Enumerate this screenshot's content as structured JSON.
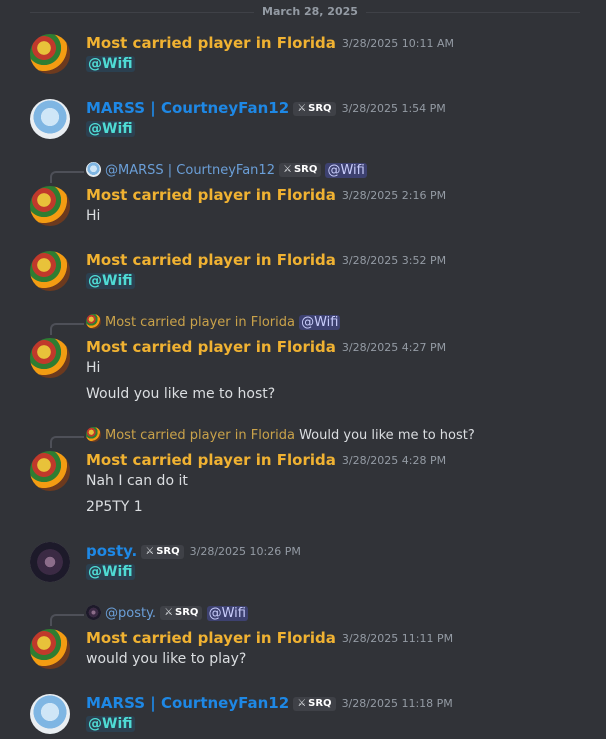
{
  "date_divider": "March 28, 2025",
  "messages": [
    {
      "author": "Most carried player in Florida",
      "time": "3/28/2025 10:11 AM",
      "lines": [
        "@Wifi"
      ]
    },
    {
      "author": "MARSS | CourtneyFan12",
      "tag": "SRQ",
      "time": "3/28/2025 1:54 PM",
      "lines": [
        "@Wifi"
      ]
    },
    {
      "reply_author": "@MARSS | CourtneyFan12",
      "reply_tag": "SRQ",
      "reply_text": "@Wifi",
      "author": "Most carried player in Florida",
      "time": "3/28/2025 2:16 PM",
      "lines": [
        "Hi"
      ]
    },
    {
      "author": "Most carried player in Florida",
      "time": "3/28/2025 3:52 PM",
      "lines": [
        "@Wifi"
      ]
    },
    {
      "reply_author": "Most carried player in Florida",
      "reply_text": "@Wifi",
      "author": "Most carried player in Florida",
      "time": "3/28/2025 4:27 PM",
      "lines": [
        "Hi",
        "Would you like me to host?"
      ]
    },
    {
      "reply_author": "Most carried player in Florida",
      "reply_text": "Would you like me to host?",
      "author": "Most carried player in Florida",
      "time": "3/28/2025 4:28 PM",
      "lines": [
        "Nah I can do it",
        "2P5TY 1"
      ]
    },
    {
      "author": "posty.",
      "tag": "SRQ",
      "time": "3/28/2025 10:26 PM",
      "lines": [
        "@Wifi"
      ]
    },
    {
      "reply_author": "@posty.",
      "reply_tag": "SRQ",
      "reply_text": "@Wifi",
      "author": "Most carried player in Florida",
      "time": "3/28/2025 11:11 PM",
      "lines": [
        "would you like to play?"
      ]
    },
    {
      "author": "MARSS | CourtneyFan12",
      "tag": "SRQ",
      "time": "3/28/2025 11:18 PM",
      "lines": [
        "@Wifi"
      ]
    }
  ],
  "icons": {
    "tag_icon": "sword-icon"
  },
  "colors": {
    "background": "#313338",
    "florida_name": "#f0b232",
    "blue_name": "#1e88e5",
    "mention": "#4fdbd4"
  }
}
